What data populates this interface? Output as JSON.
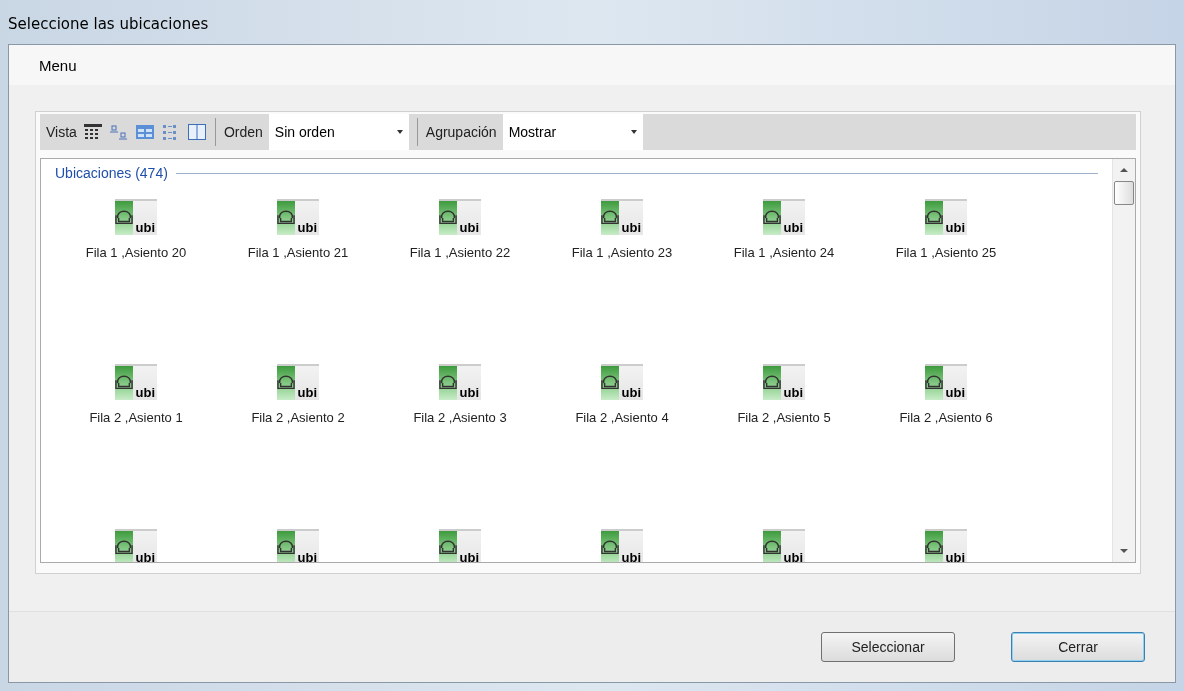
{
  "window": {
    "title": "Seleccione las ubicaciones"
  },
  "menu": [
    "Menu"
  ],
  "toolbar": {
    "view_label": "Vista",
    "order_label": "Orden",
    "order_value": "Sin orden",
    "group_label": "Agrupación",
    "group_value": "Mostrar"
  },
  "group": {
    "title": "Ubicaciones (474)"
  },
  "items": [
    {
      "label": "Fila 1 ,Asiento 20",
      "badge": "ubi"
    },
    {
      "label": "Fila 1 ,Asiento 21",
      "badge": "ubi"
    },
    {
      "label": "Fila 1 ,Asiento 22",
      "badge": "ubi"
    },
    {
      "label": "Fila 1 ,Asiento 23",
      "badge": "ubi"
    },
    {
      "label": "Fila 1 ,Asiento 24",
      "badge": "ubi"
    },
    {
      "label": "Fila 1 ,Asiento 25",
      "badge": "ubi"
    },
    {
      "label": "Fila 2 ,Asiento 1",
      "badge": "ubi"
    },
    {
      "label": "Fila 2 ,Asiento 2",
      "badge": "ubi"
    },
    {
      "label": "Fila 2 ,Asiento 3",
      "badge": "ubi"
    },
    {
      "label": "Fila 2 ,Asiento 4",
      "badge": "ubi"
    },
    {
      "label": "Fila 2 ,Asiento 5",
      "badge": "ubi"
    },
    {
      "label": "Fila 2 ,Asiento 6",
      "badge": "ubi"
    },
    {
      "badge": "ubi"
    },
    {
      "badge": "ubi"
    },
    {
      "badge": "ubi"
    },
    {
      "badge": "ubi"
    },
    {
      "badge": "ubi"
    },
    {
      "badge": "ubi"
    }
  ],
  "buttons": [
    "Seleccionar",
    "Cerrar"
  ]
}
